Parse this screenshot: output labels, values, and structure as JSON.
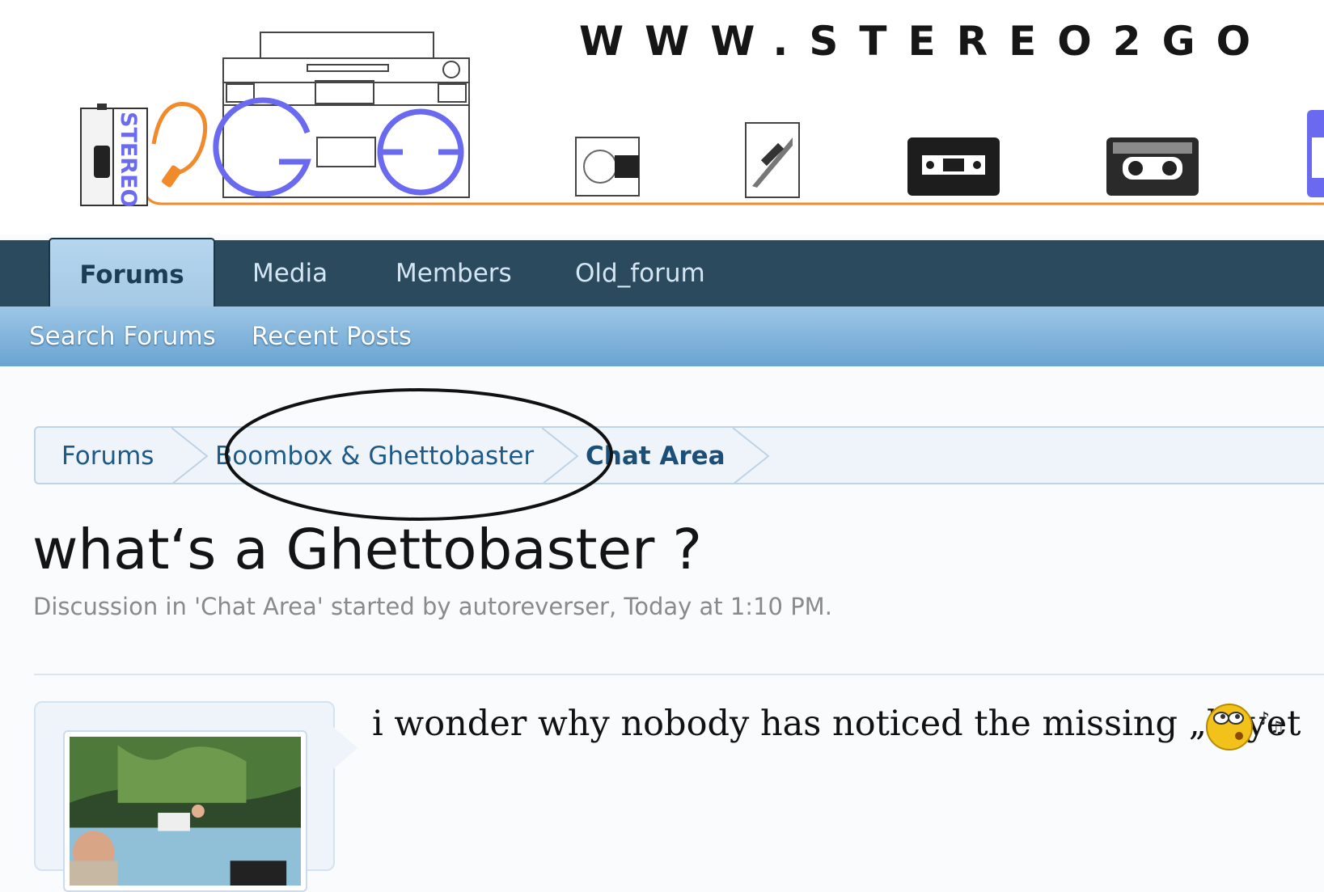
{
  "header": {
    "site_url": "WWW.STEREO2GO",
    "logo_text": "STEREO"
  },
  "nav": {
    "tabs": [
      {
        "label": "Forums",
        "active": true
      },
      {
        "label": "Media",
        "active": false
      },
      {
        "label": "Members",
        "active": false
      },
      {
        "label": "Old_forum",
        "active": false
      }
    ],
    "subnav": [
      "Search Forums",
      "Recent Posts"
    ]
  },
  "breadcrumb": {
    "items": [
      "Forums",
      "Boombox & Ghettobaster",
      "Chat Area"
    ]
  },
  "thread": {
    "title": "what‘s a Ghettobaster ?",
    "meta": "Discussion in 'Chat Area' started by autoreverser, Today at 1:10 PM."
  },
  "message": {
    "text": "i wonder why nobody has noticed the missing „l“ yet",
    "emoji_icon": "whistling-smiley-icon"
  },
  "colors": {
    "nav_dark": "#2c4a5e",
    "subnav_blue": "#7fb3dc",
    "link_blue": "#1f5a86",
    "logo_purple": "#6a6af0",
    "cable_orange": "#f08a2a"
  }
}
